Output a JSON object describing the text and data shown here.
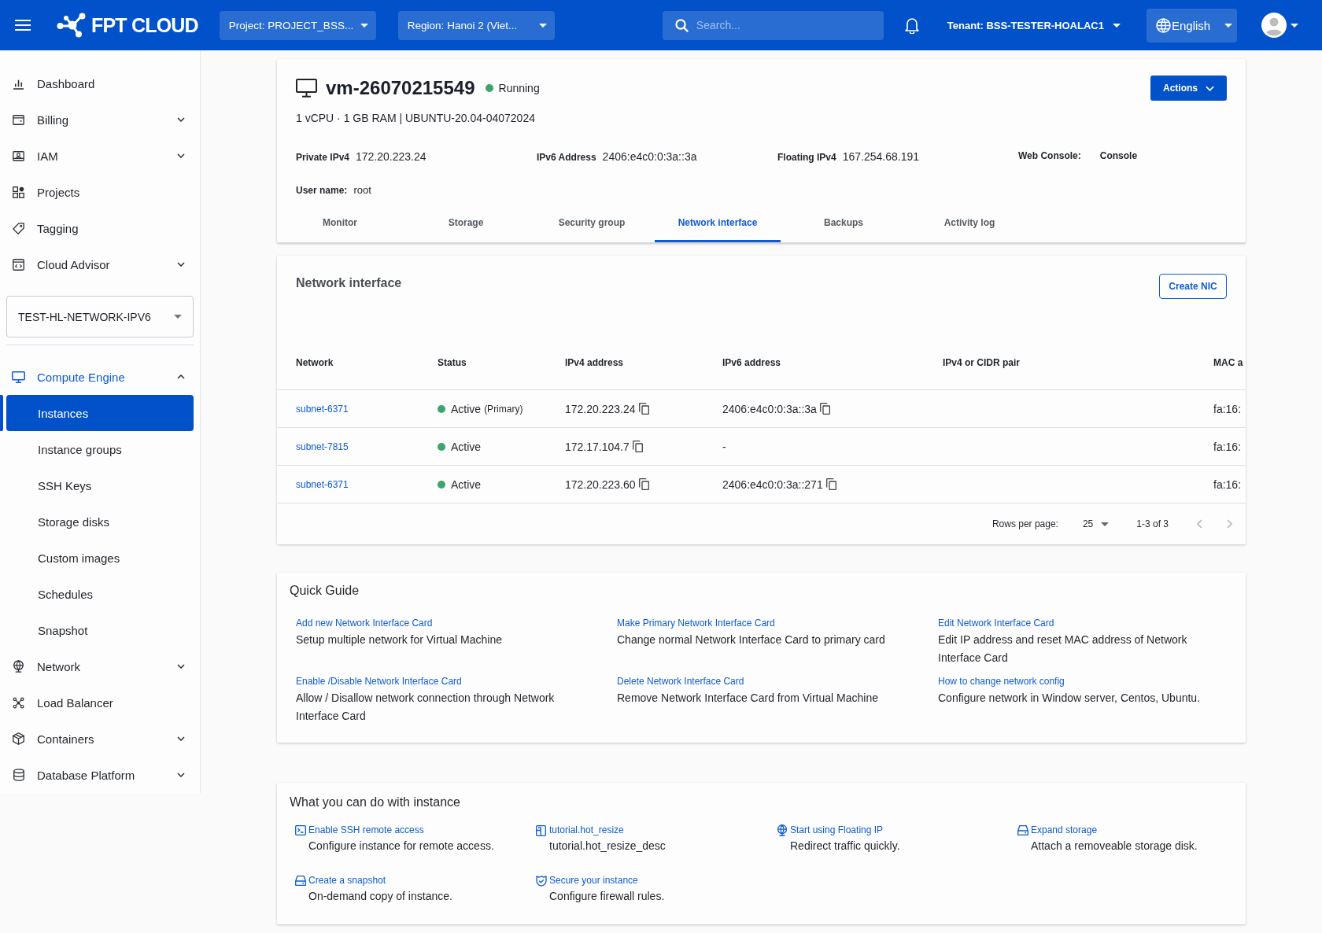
{
  "top_bar": {
    "logo": "FPT CLOUD",
    "project": "Project: PROJECT_BSS...",
    "region": "Region: Hanoi 2 (Viet...",
    "search": {
      "placeholder": "Search..."
    },
    "tenant": "Tenant: BSS-TESTER-HOALAC1",
    "language": "English"
  },
  "sidebar": {
    "items": [
      {
        "kind": "link",
        "label": "Dashboard"
      },
      {
        "kind": "group",
        "label": "Billing",
        "expanded": false
      },
      {
        "kind": "group",
        "label": "IAM",
        "expanded": false
      },
      {
        "kind": "link",
        "label": "Projects"
      },
      {
        "kind": "link",
        "label": "Tagging"
      },
      {
        "kind": "group",
        "label": "Cloud Advisor",
        "expanded": false
      },
      {
        "kind": "select",
        "value": "TEST-HL-NETWORK-IPV6"
      },
      {
        "kind": "group",
        "label": "Compute Engine",
        "expanded": true,
        "children": [
          {
            "label": "Instances",
            "selected": true
          },
          {
            "label": "Instance groups",
            "selected": false
          },
          {
            "label": "SSH Keys",
            "selected": false
          },
          {
            "label": "Storage disks",
            "selected": false
          },
          {
            "label": "Custom images",
            "selected": false
          },
          {
            "label": "Schedules",
            "selected": false
          },
          {
            "label": "Snapshot",
            "selected": false
          }
        ]
      },
      {
        "kind": "group",
        "label": "Network",
        "expanded": false
      },
      {
        "kind": "link",
        "label": "Load Balancer"
      },
      {
        "kind": "group",
        "label": "Containers",
        "expanded": false
      },
      {
        "kind": "group",
        "label": "Database Platform",
        "expanded": false
      }
    ]
  },
  "instance": {
    "name": "vm-26070215549",
    "status": "Running",
    "specs": "1 vCPU · 1 GB RAM | UBUNTU-20.04-04072024",
    "actions_button": "Actions",
    "details": [
      {
        "kind": "text",
        "label": "Private IPv4",
        "value": "172.20.223.24"
      },
      {
        "kind": "text",
        "label": "IPv6 Address",
        "value": "2406:e4c0:0:3a::3a"
      },
      {
        "kind": "text",
        "label": "Floating IPv4",
        "value": "167.254.68.191"
      },
      {
        "kind": "link",
        "label": "Web Console:",
        "value": "Console"
      },
      {
        "kind": "text",
        "label": "User name:",
        "value": "root"
      }
    ],
    "tabs": [
      {
        "label": "Monitor",
        "selected": false
      },
      {
        "label": "Storage",
        "selected": false
      },
      {
        "label": "Security group",
        "selected": false
      },
      {
        "label": "Network interface",
        "selected": true
      },
      {
        "label": "Backups",
        "selected": false
      },
      {
        "label": "Activity log",
        "selected": false
      }
    ]
  },
  "network_interface": {
    "title": "Network interface",
    "create_button": "Create NIC",
    "columns": [
      "Network",
      "Status",
      "IPv4 address",
      "IPv6 address",
      "IPv4 or CIDR pair",
      "MAC a"
    ],
    "rows": [
      {
        "network": "subnet-6371",
        "status": "Active",
        "note": "(Primary)",
        "ipv4": {
          "text": "172.20.223.24",
          "copy": true
        },
        "ipv6": {
          "text": "2406:e4c0:0:3a::3a",
          "copy": true
        },
        "mac": "fa:16:"
      },
      {
        "network": "subnet-7815",
        "status": "Active",
        "ipv4": {
          "text": "172.17.104.7",
          "copy": true
        },
        "ipv6": {
          "text": "-",
          "copy": false
        },
        "mac": "fa:16:"
      },
      {
        "network": "subnet-6371",
        "status": "Active",
        "ipv4": {
          "text": "172.20.223.60",
          "copy": true
        },
        "ipv6": {
          "text": "2406:e4c0:0:3a::271",
          "copy": true
        },
        "mac": "fa:16:"
      }
    ],
    "pagination": {
      "label": "Rows per page:",
      "rows_per_page": "25",
      "range": "1-3 of 3",
      "prev_disabled": true,
      "next_disabled": true
    }
  },
  "quick_guide": {
    "title": "Quick Guide",
    "items": [
      {
        "link": "Add new Network Interface Card",
        "description": "Setup multiple network for Virtual Machine"
      },
      {
        "link": "Make Primary Network Interface Card",
        "description": "Change normal Network Interface Card to primary card"
      },
      {
        "link": "Edit Network Interface Card",
        "description": "Edit IP address and reset MAC address of Network Interface Card"
      },
      {
        "link": "Enable /Disable Network Interface Card",
        "description": "Allow / Disallow network connection through Network Interface Card"
      },
      {
        "link": "Delete Network Interface Card",
        "description": "Remove Network Interface Card from Virtual Machine"
      },
      {
        "link": "How to change network config",
        "description": "Configure network in Window server, Centos, Ubuntu."
      }
    ]
  },
  "what_you_can_do": {
    "title": "What you can do with instance",
    "items": [
      {
        "link": "Enable SSH remote access",
        "description": "Configure instance for remote access."
      },
      {
        "link": "tutorial.hot_resize",
        "description": "tutorial.hot_resize_desc"
      },
      {
        "link": "Start using Floating IP",
        "description": "Redirect traffic quickly."
      },
      {
        "link": "Expand storage",
        "description": "Attach a removeable storage disk."
      },
      {
        "link": "Create a snapshot",
        "description": "On-demand copy of instance."
      },
      {
        "link": "Secure your instance",
        "description": "Configure firewall rules."
      }
    ]
  }
}
